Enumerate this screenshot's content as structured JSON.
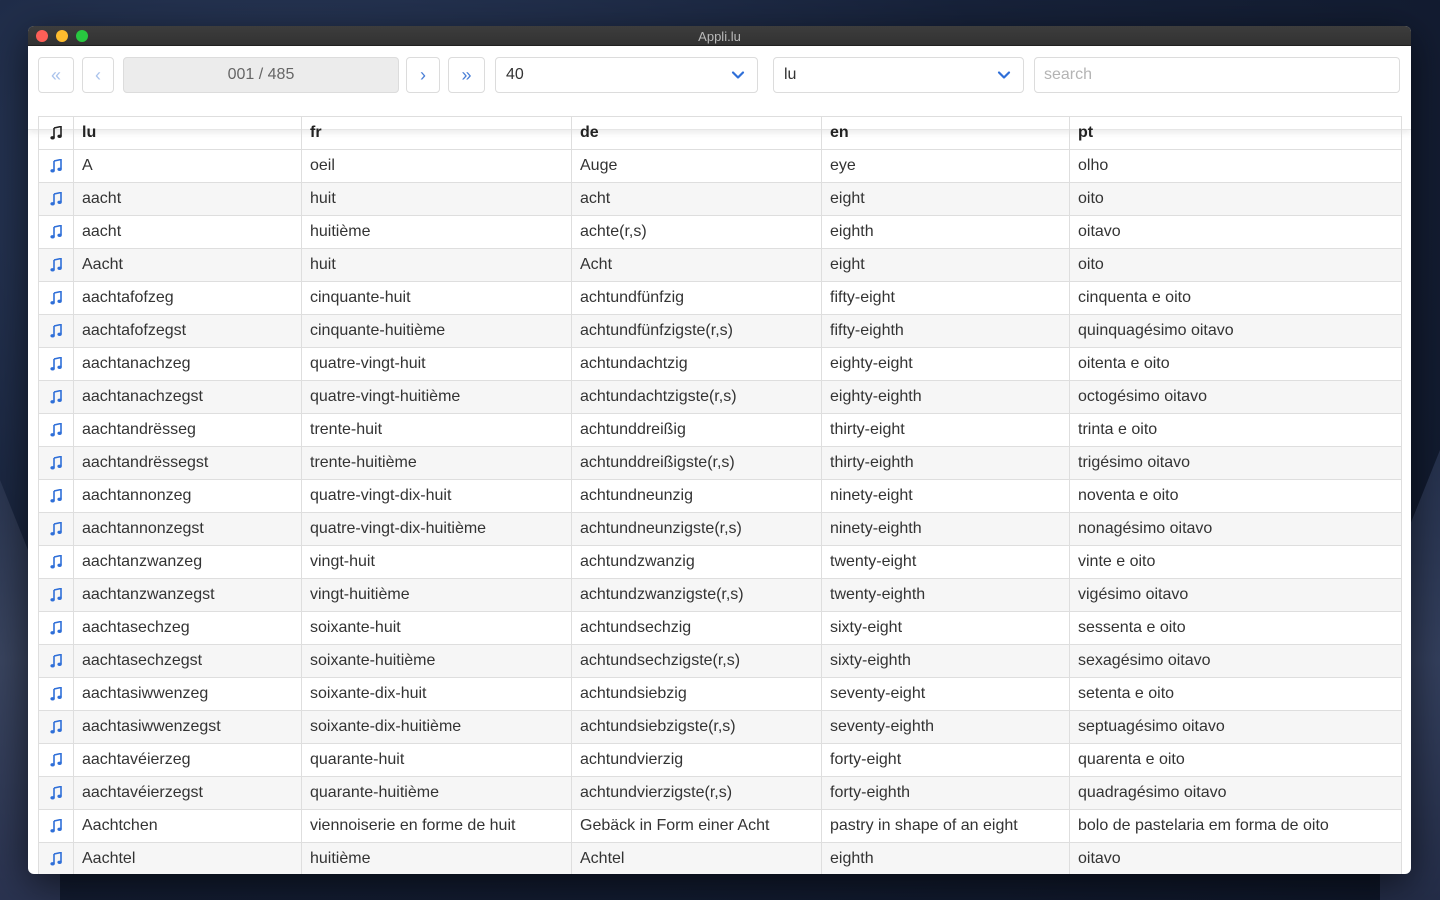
{
  "window": {
    "title": "Appli.lu"
  },
  "toolbar": {
    "first_label": "«",
    "prev_label": "‹",
    "counter": "001 / 485",
    "next_label": "›",
    "last_label": "»",
    "page_size": "40",
    "language": "lu",
    "search_placeholder": "search"
  },
  "colors": {
    "accent": "#4a7fd6",
    "disabled": "#aac3ec"
  },
  "table": {
    "headers": {
      "audio": "music-note-icon",
      "lu": "lu",
      "fr": "fr",
      "de": "de",
      "en": "en",
      "pt": "pt"
    },
    "rows": [
      [
        "A",
        "oeil",
        "Auge",
        "eye",
        "olho"
      ],
      [
        "aacht",
        "huit",
        "acht",
        "eight",
        "oito"
      ],
      [
        "aacht",
        "huitième",
        "achte(r,s)",
        "eighth",
        "oitavo"
      ],
      [
        "Aacht",
        "huit",
        "Acht",
        "eight",
        "oito"
      ],
      [
        "aachtafofzeg",
        "cinquante-huit",
        "achtundfünfzig",
        "fifty-eight",
        "cinquenta e oito"
      ],
      [
        "aachtafofzegst",
        "cinquante-huitième",
        "achtundfünfzigste(r,s)",
        "fifty-eighth",
        "quinquagésimo oitavo"
      ],
      [
        "aachtanachzeg",
        "quatre-vingt-huit",
        "achtundachtzig",
        "eighty-eight",
        "oitenta e oito"
      ],
      [
        "aachtanachzegst",
        "quatre-vingt-huitième",
        "achtundachtzigste(r,s)",
        "eighty-eighth",
        "octogésimo oitavo"
      ],
      [
        "aachtandrësseg",
        "trente-huit",
        "achtunddreißig",
        "thirty-eight",
        "trinta e oito"
      ],
      [
        "aachtandrëssegst",
        "trente-huitième",
        "achtunddreißigste(r,s)",
        "thirty-eighth",
        "trigésimo oitavo"
      ],
      [
        "aachtannonzeg",
        "quatre-vingt-dix-huit",
        "achtundneunzig",
        "ninety-eight",
        "noventa e oito"
      ],
      [
        "aachtannonzegst",
        "quatre-vingt-dix-huitième",
        "achtundneunzigste(r,s)",
        "ninety-eighth",
        "nonagésimo oitavo"
      ],
      [
        "aachtanzwanzeg",
        "vingt-huit",
        "achtundzwanzig",
        "twenty-eight",
        "vinte e oito"
      ],
      [
        "aachtanzwanzegst",
        "vingt-huitième",
        "achtundzwanzigste(r,s)",
        "twenty-eighth",
        "vigésimo oitavo"
      ],
      [
        "aachtasechzeg",
        "soixante-huit",
        "achtundsechzig",
        "sixty-eight",
        "sessenta e oito"
      ],
      [
        "aachtasechzegst",
        "soixante-huitième",
        "achtundsechzigste(r,s)",
        "sixty-eighth",
        "sexagésimo oitavo"
      ],
      [
        "aachtasiwwenzeg",
        "soixante-dix-huit",
        "achtundsiebzig",
        "seventy-eight",
        "setenta e oito"
      ],
      [
        "aachtasiwwenzegst",
        "soixante-dix-huitième",
        "achtundsiebzigste(r,s)",
        "seventy-eighth",
        "septuagésimo oitavo"
      ],
      [
        "aachtavéierzeg",
        "quarante-huit",
        "achtundvierzig",
        "forty-eight",
        "quarenta e oito"
      ],
      [
        "aachtavéierzegst",
        "quarante-huitième",
        "achtundvierzigste(r,s)",
        "forty-eighth",
        "quadragésimo oitavo"
      ],
      [
        "Aachtchen",
        "viennoiserie en forme de huit",
        "Gebäck in Form einer Acht",
        "pastry in shape of an eight",
        "bolo de pastelaria em forma de oito"
      ],
      [
        "Aachtel",
        "huitième",
        "Achtel",
        "eighth",
        "oitavo"
      ]
    ]
  }
}
